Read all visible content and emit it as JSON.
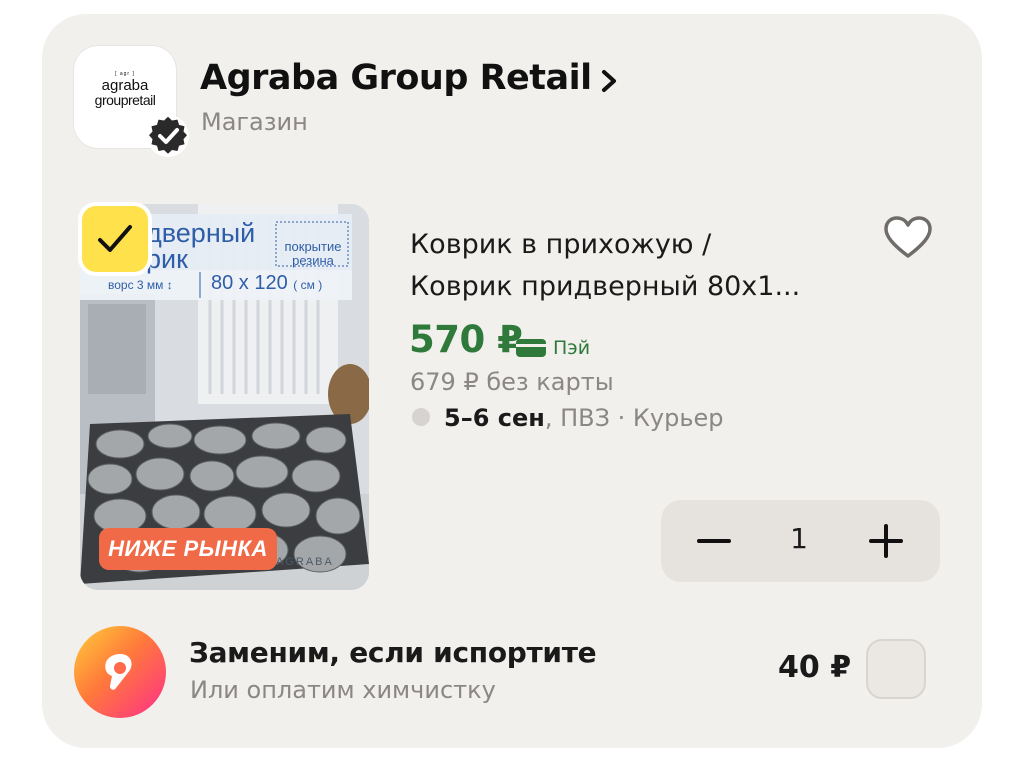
{
  "store": {
    "logo_small": "[ agr ]",
    "logo_line1": "agraba",
    "logo_line2": "groupretail",
    "name": "Agraba Group Retail",
    "type": "Магазин"
  },
  "product": {
    "title_line1": "Коврик в прихожую /",
    "title_line2": "Коврик придверный 80х1...",
    "price": "570 ₽",
    "pay_label": "Пэй",
    "old_price": "679 ₽ без карты",
    "delivery_date": "5–6 сен",
    "delivery_rest": ", ПВЗ · Курьер",
    "image_texts": {
      "title_part1": "дверный",
      "title_part2": "рик",
      "coating": "покрытие резина",
      "pile": "ворс 3 мм ↕",
      "size": "80 x 120",
      "size_unit": "( см )",
      "promo": "НИЖЕ РЫНКА",
      "brand": "AGRABA"
    },
    "selected": true
  },
  "cart": {
    "quantity": "1"
  },
  "protection": {
    "title": "Заменим, если испортите",
    "subtitle": "Или оплатим химчистку",
    "price": "40 ₽",
    "checked": false
  },
  "colors": {
    "card_bg": "#f2f0ed",
    "price_green": "#2f7a3b",
    "check_yellow": "#ffe14b",
    "promo_orange": "#f06a47",
    "muted": "#8a8784"
  }
}
